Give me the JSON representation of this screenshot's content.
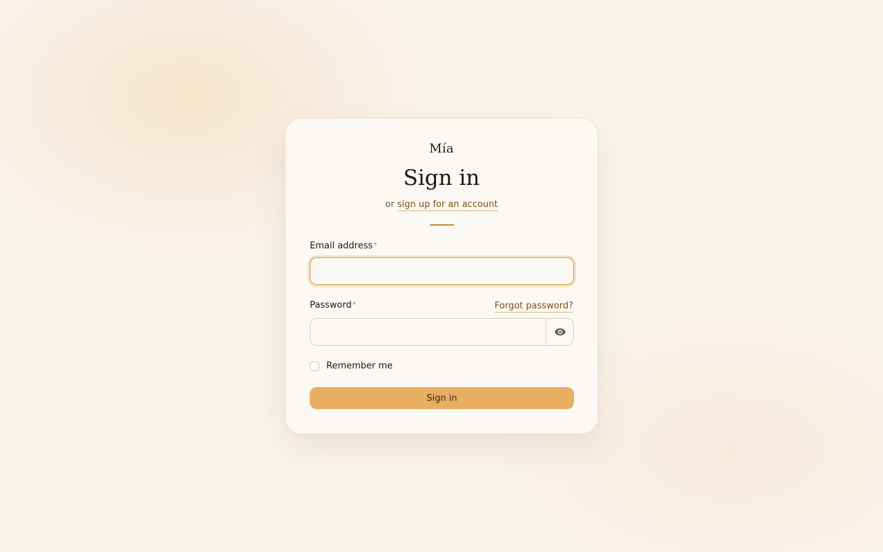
{
  "app": {
    "brand_name": "Mía"
  },
  "header": {
    "title": "Sign in",
    "subtitle_prefix": "or",
    "signup_link": "sign up for an account"
  },
  "form": {
    "email": {
      "label": "Email address",
      "required_mark": "*",
      "value": "",
      "placeholder": ""
    },
    "password": {
      "label": "Password",
      "required_mark": "*",
      "value": "",
      "placeholder": "",
      "forgot_link": "Forgot password?",
      "toggle_icon": "eye-icon"
    },
    "remember": {
      "label": "Remember me",
      "checked": false
    },
    "submit_label": "Sign in"
  },
  "colors": {
    "accent": "#e8ae62",
    "link": "#7a4f10",
    "required": "#d07a44",
    "focus_border": "#d29a48",
    "divider": "#c8882d",
    "card_background": "#fcf9f4",
    "page_background": "#f8f3ec"
  }
}
